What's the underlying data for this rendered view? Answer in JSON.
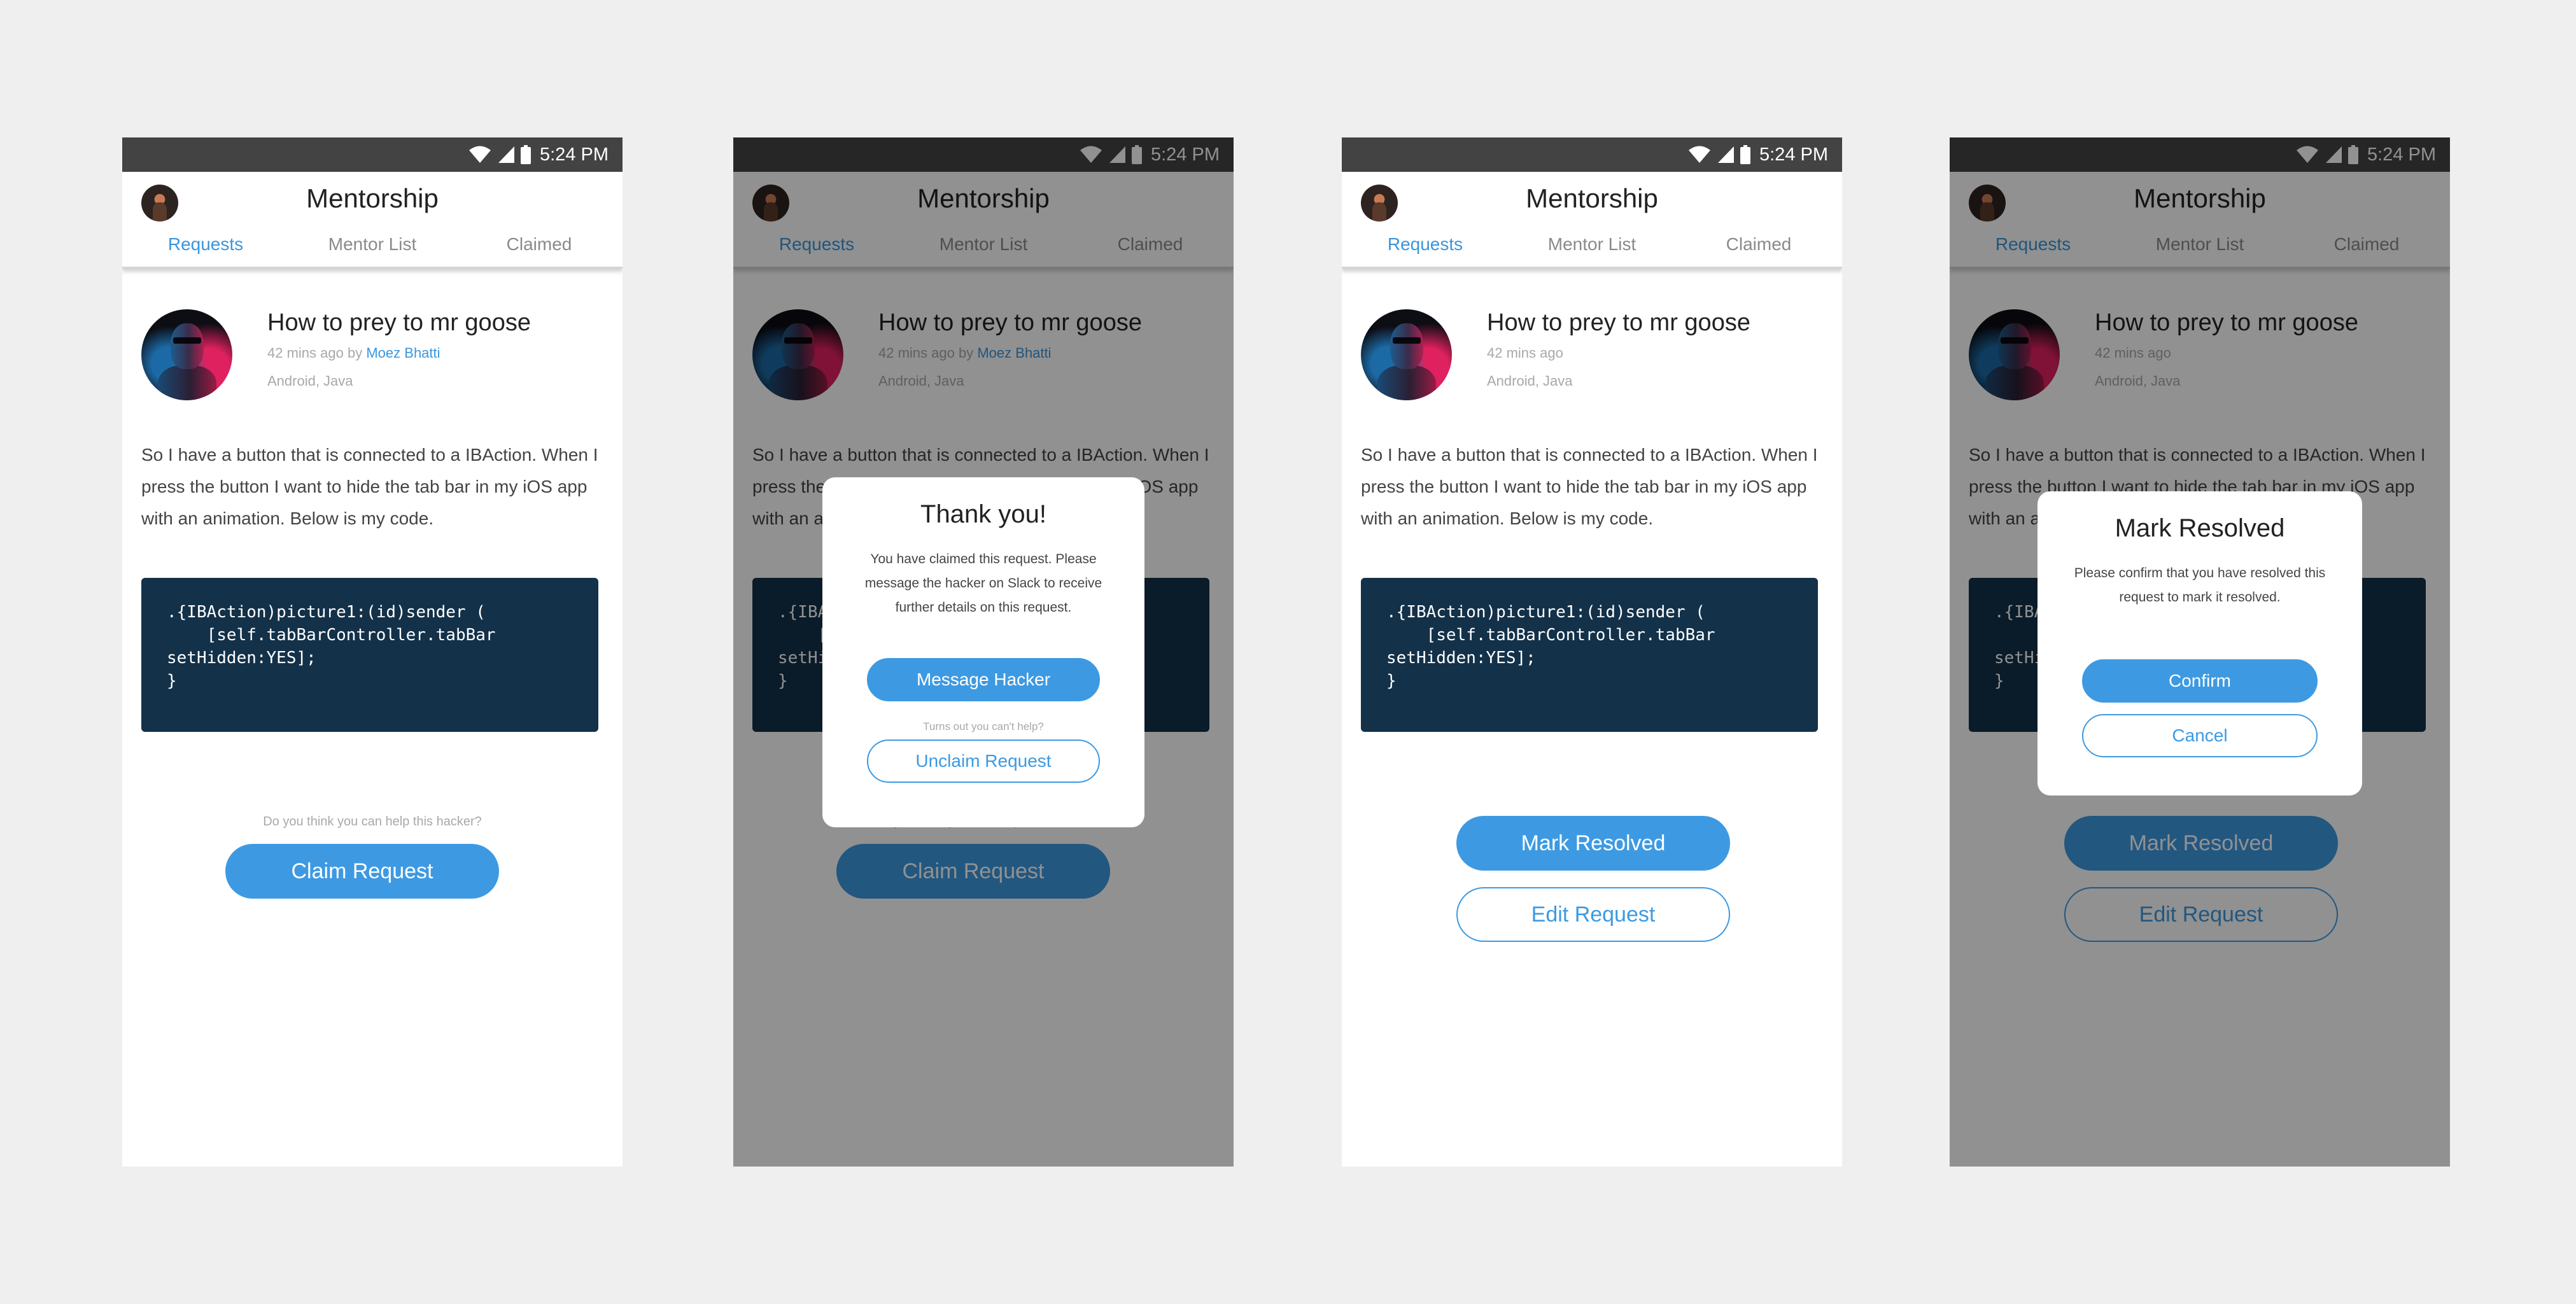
{
  "status_bar": {
    "time": "5:24 PM"
  },
  "header": {
    "title": "Mentorship",
    "tabs": [
      "Requests",
      "Mentor List",
      "Claimed"
    ]
  },
  "request": {
    "title": "How to prey to mr goose",
    "time_ago": "42 mins ago",
    "by_label": "by",
    "author": "Moez Bhatti",
    "tags": "Android, Java",
    "body": "So I have a button that is connected to a IBAction. When I press the button I want to hide the tab bar in my iOS app with an animation. Below is my code.",
    "code": ".{IBAction)picture1:(id)sender (\n    [self.tabBarController.tabBar\nsetHidden:YES];\n}"
  },
  "claim_screen": {
    "hint": "Do you think you can help this hacker?",
    "claim_button": "Claim Request"
  },
  "claimed_dialog": {
    "title": "Thank you!",
    "message": "You have claimed this request. Please message the hacker on Slack to receive further details on this request.",
    "primary_button": "Message Hacker",
    "small_text": "Turns out you can't help?",
    "secondary_button": "Unclaim Request",
    "behind_hint": "Do you think you can help this hacker?"
  },
  "resolve_screen": {
    "mark_button": "Mark Resolved",
    "edit_button": "Edit Request"
  },
  "resolve_dialog": {
    "title": "Mark Resolved",
    "message": "Please confirm that you have resolved this request to mark it resolved.",
    "confirm_button": "Confirm",
    "cancel_button": "Cancel"
  },
  "colors": {
    "accent": "#3d9ae2",
    "status_bar": "#434343",
    "code_bg": "#133149",
    "background": "#efefef"
  }
}
